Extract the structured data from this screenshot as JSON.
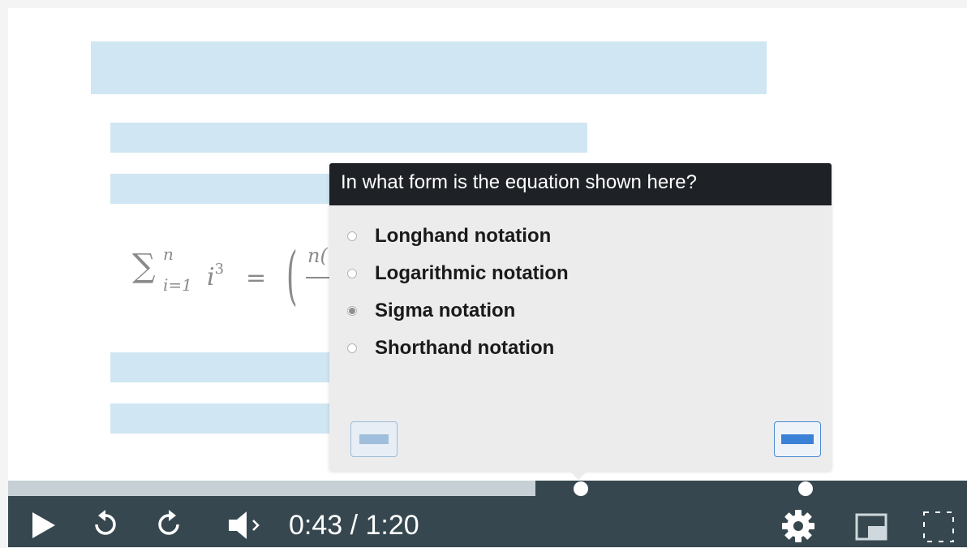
{
  "quiz": {
    "question": "In what form is the equation shown here?",
    "options": [
      {
        "label": "Longhand notation",
        "selected": false
      },
      {
        "label": "Logarithmic notation",
        "selected": false
      },
      {
        "label": "Sigma notation",
        "selected": true
      },
      {
        "label": "Shorthand notation",
        "selected": false
      }
    ]
  },
  "equation": {
    "sigma": "∑",
    "upper": "n",
    "lower": "i=1",
    "term": "i",
    "exponent": "3",
    "equals": "=",
    "paren": "(",
    "numerator_fragment": "n("
  },
  "player": {
    "time": "0:43 / 1:20",
    "progress_fraction": 0.55,
    "marker_positions_fraction": [
      0.597,
      0.832
    ],
    "icons": [
      "play-icon",
      "rewind-icon",
      "forward-icon",
      "volume-icon",
      "gear-icon",
      "pip-icon",
      "fullscreen-icon"
    ]
  },
  "colors": {
    "accent": "#3b82d6",
    "placeholder": "#d0e6f2",
    "controls_bg": "#36474f",
    "header_bg": "#1e2125"
  }
}
